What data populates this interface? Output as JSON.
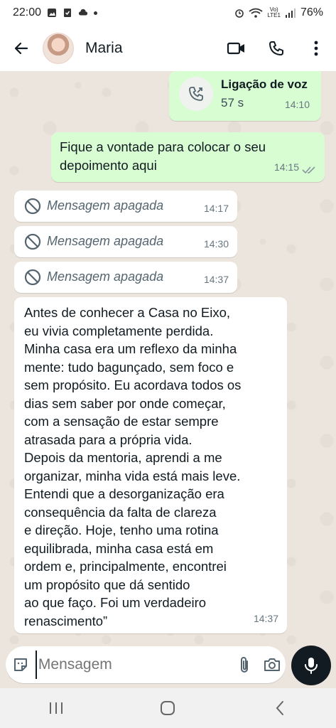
{
  "status_bar": {
    "time": "22:00",
    "volte_line1": "Vo)",
    "volte_line2": "LTE1",
    "battery": "76%"
  },
  "header": {
    "contact_name": "Maria"
  },
  "messages": [
    {
      "type": "call",
      "direction": "out",
      "title": "Ligação de voz",
      "duration": "57 s",
      "time": "14:10"
    },
    {
      "type": "text",
      "direction": "out",
      "text": "Fique a vontade para colocar o seu\ndepoimento aqui",
      "time": "14:15",
      "status": "read"
    },
    {
      "type": "deleted",
      "direction": "in",
      "text": "Mensagem apagada",
      "time": "14:17"
    },
    {
      "type": "deleted",
      "direction": "in",
      "text": "Mensagem apagada",
      "time": "14:30"
    },
    {
      "type": "deleted",
      "direction": "in",
      "text": "Mensagem apagada",
      "time": "14:37"
    },
    {
      "type": "text",
      "direction": "in",
      "text": "Antes de conhecer a Casa no Eixo,\neu vivia completamente perdida.\nMinha casa era um reflexo da minha\nmente: tudo bagunçado, sem foco e\nsem propósito. Eu acordava todos os\ndias sem saber por onde começar,\ncom a sensação de estar sempre\natrasada para a própria vida.\nDepois da mentoria, aprendi a me\norganizar, minha vida está mais leve.\nEntendi que a desorganização era\nconsequência da falta de clareza\ne direção. Hoje, tenho uma rotina\nequilibrada, minha casa está em\nordem e, principalmente, encontrei\num propósito que dá sentido\nao que faço. Foi um verdadeiro\nrenascimento”",
      "time": "14:37"
    }
  ],
  "composer": {
    "placeholder": "Mensagem"
  },
  "colors": {
    "outgoing_bubble": "#d9fdd3",
    "incoming_bubble": "#ffffff",
    "chat_background": "#ece5dd",
    "read_ticks": "#8696a0"
  }
}
